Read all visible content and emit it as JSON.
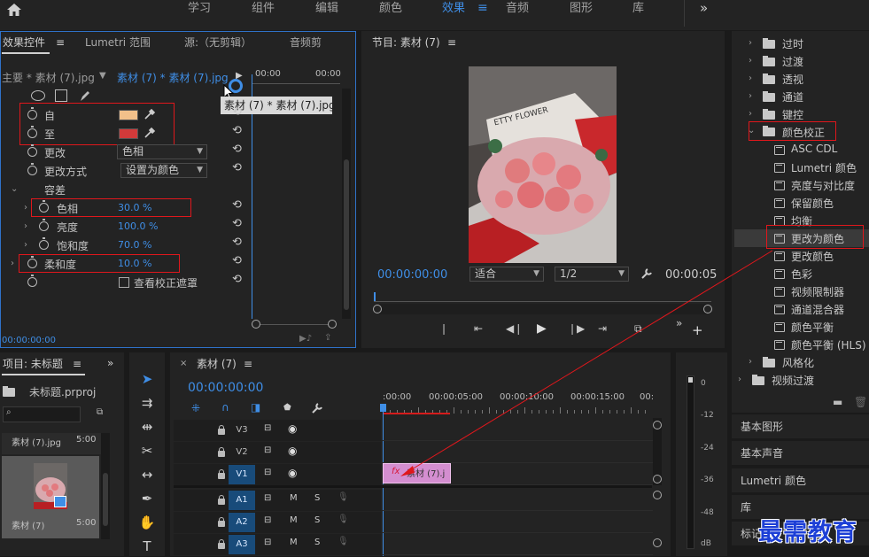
{
  "workspace": {
    "home_icon": "home-icon",
    "tabs": [
      "学习",
      "组件",
      "编辑",
      "颜色",
      "效果",
      "音频",
      "图形",
      "库"
    ],
    "active": "效果",
    "more": "»"
  },
  "effect_controls": {
    "tab_effect": "效果控件",
    "tab_lumetri": "Lumetri 范围",
    "tab_source": "源:（无剪辑）",
    "tab_audio": "音频剪",
    "master_clip": "主要 * 素材 (7).jpg",
    "clip_path": "素材 (7) * 素材 (7).jpg",
    "tooltip": "素材 (7) * 素材 (7).jpg",
    "tc_a": "00:00",
    "tc_b": "00:00",
    "from": "自",
    "to": "至",
    "from_color": "#f2c08a",
    "to_color": "#d23a3a",
    "change": "更改",
    "change_value": "色相",
    "change_method": "更改方式",
    "change_method_value": "设置为颜色",
    "tolerance": "容差",
    "hue": "色相",
    "hue_value": "30.0 %",
    "brightness": "亮度",
    "brightness_value": "100.0 %",
    "saturation": "饱和度",
    "saturation_value": "70.0 %",
    "softness": "柔和度",
    "softness_value": "10.0 %",
    "show_mask": "查看校正遮罩",
    "timecode": "00:00:00:00"
  },
  "program": {
    "title": "节目: 素材 (7)",
    "timecode": "00:00:00:00",
    "fit": "适合",
    "resolution": "1/2",
    "duration": "00:00:05",
    "photo_text": "ETTY FLOWER"
  },
  "effects_tree": {
    "folders": [
      "过时",
      "过渡",
      "透视",
      "通道",
      "键控"
    ],
    "color_folder": "颜色校正",
    "items": [
      "ASC CDL",
      "Lumetri 颜色",
      "亮度与对比度",
      "保留颜色",
      "均衡",
      "更改为颜色",
      "更改颜色",
      "色彩",
      "视频限制器",
      "通道混合器",
      "颜色平衡",
      "颜色平衡 (HLS)"
    ],
    "stylize": "风格化",
    "video_transitions": "视频过渡"
  },
  "side_panels": [
    "基本图形",
    "基本声音",
    "Lumetri 颜色",
    "库",
    "标记"
  ],
  "project": {
    "title": "项目: 未标题",
    "file": "未标题.prproj",
    "search_placeholder": "",
    "clip_top": "素材 (7).jpg",
    "clip_top_dur": "5:00",
    "clip_name": "素材 (7)",
    "clip_dur": "5:00"
  },
  "timeline": {
    "tab": "素材 (7)",
    "timecode": "00:00:00:00",
    "ruler": [
      ":00:00",
      "00:00:05:00",
      "00:00:10:00",
      "00:00:15:00",
      "00:"
    ],
    "tracks_video": [
      "V3",
      "V2",
      "V1"
    ],
    "tracks_audio": [
      "A1",
      "A2",
      "A3"
    ],
    "clip_label": "素材 (7).j",
    "fx_badge": "fx",
    "m": "M",
    "s": "S"
  },
  "audio_meter": {
    "ticks": [
      "0",
      "-12",
      "-24",
      "-36",
      "-48",
      "dB"
    ]
  },
  "watermark": "最需教育"
}
